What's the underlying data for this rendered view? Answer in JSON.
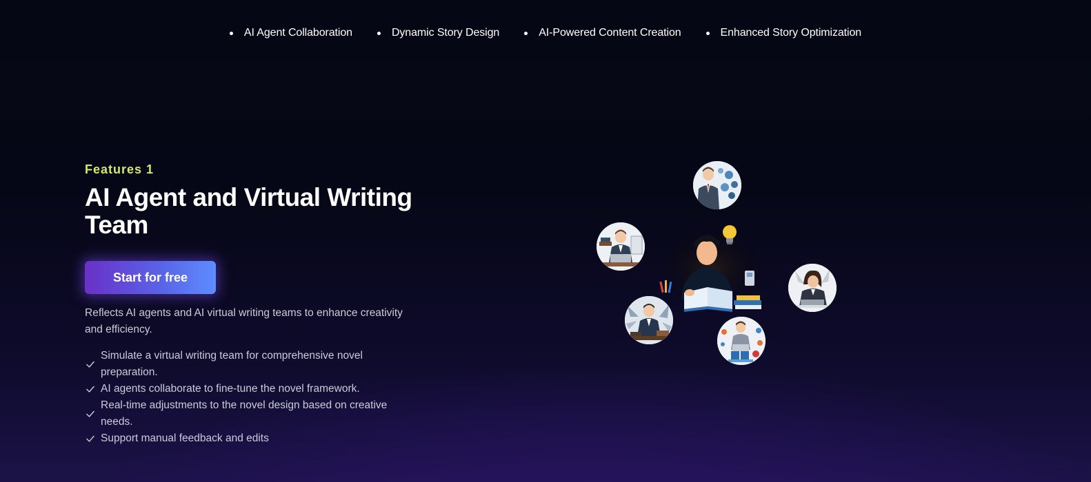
{
  "top_nav": {
    "items": [
      {
        "label": "AI Agent Collaboration"
      },
      {
        "label": "Dynamic Story Design"
      },
      {
        "label": "AI-Powered Content Creation"
      },
      {
        "label": "Enhanced Story Optimization"
      }
    ]
  },
  "feature": {
    "eyebrow": "Features 1",
    "title": "AI Agent and Virtual Writing Team",
    "cta_label": "Start for free",
    "description": "Reflects AI agents and AI virtual writing teams to enhance creativity and efficiency.",
    "bullets": [
      "Simulate a virtual writing team for comprehensive novel preparation.",
      "AI agents collaborate to fine-tune the novel framework.",
      "Real-time adjustments to the novel design based on creative needs.",
      "Support manual feedback and edits"
    ]
  },
  "colors": {
    "eyebrow": "#d6e86b",
    "cta_start": "#6a30c8",
    "cta_end": "#5e8cff",
    "background": "#050814"
  },
  "icons": {
    "bullet": "dot",
    "check": "check-icon",
    "lightbulb": "lightbulb-icon"
  }
}
